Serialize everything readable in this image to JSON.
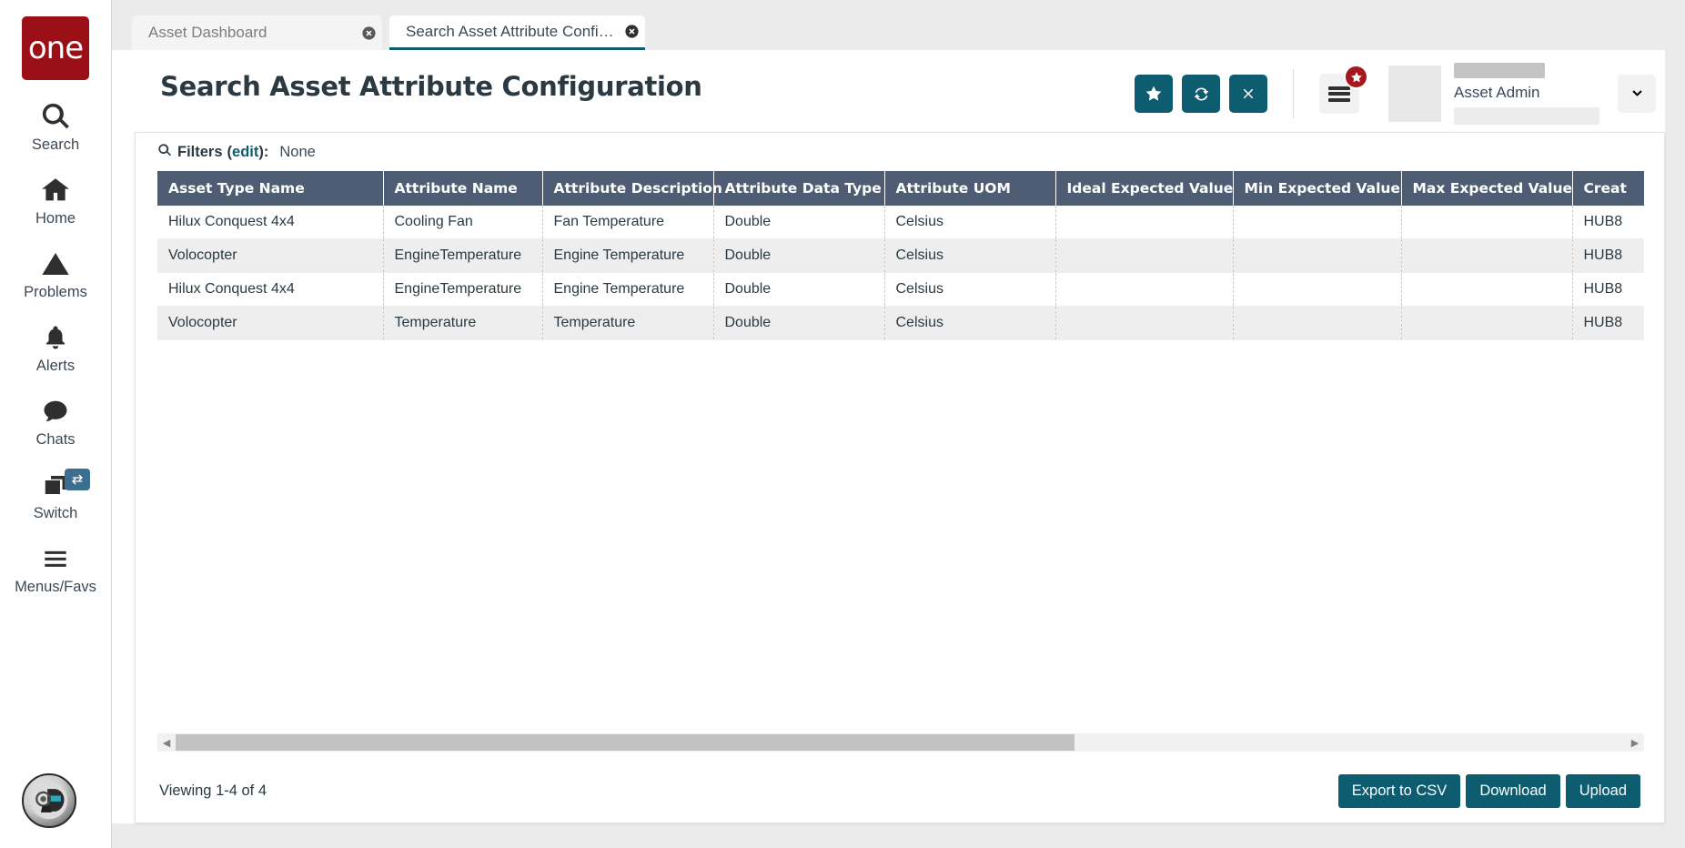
{
  "brand": {
    "logo_text": "one"
  },
  "sidebar": {
    "items": [
      {
        "label": "Search",
        "icon": "search-icon"
      },
      {
        "label": "Home",
        "icon": "home-icon"
      },
      {
        "label": "Problems",
        "icon": "warning-triangle-icon"
      },
      {
        "label": "Alerts",
        "icon": "bell-icon"
      },
      {
        "label": "Chats",
        "icon": "chat-bubble-icon"
      },
      {
        "label": "Switch",
        "icon": "windows-stack-icon",
        "badge_icon": "swap-arrows-icon"
      },
      {
        "label": "Menus/Favs",
        "icon": "hamburger-icon"
      }
    ],
    "avatar_icon": "robot-head-avatar-icon"
  },
  "tabs": [
    {
      "label": "Asset Dashboard",
      "active": false
    },
    {
      "label": "Search Asset Attribute Configura...",
      "active": true
    }
  ],
  "header": {
    "title": "Search Asset Attribute Configuration",
    "actions": [
      {
        "name": "favorite-button",
        "icon": "star-icon"
      },
      {
        "name": "refresh-button",
        "icon": "refresh-icon"
      },
      {
        "name": "close-button",
        "icon": "x-icon"
      }
    ],
    "menu_badge_icon": "star-icon",
    "user": {
      "role": "Asset Admin"
    }
  },
  "filters": {
    "icon": "search-icon",
    "label": "Filters",
    "edit_label": "edit",
    "separator": "):",
    "open_paren": "(",
    "value": "None"
  },
  "table": {
    "columns": [
      "Asset Type Name",
      "Attribute Name",
      "Attribute Description",
      "Attribute Data Type",
      "Attribute UOM",
      "Ideal Expected Value",
      "Min Expected Value",
      "Max Expected Value",
      "Creat"
    ],
    "rows": [
      [
        "Hilux Conquest 4x4",
        "Cooling Fan",
        "Fan Temperature",
        "Double",
        "Celsius",
        "",
        "",
        "",
        "HUB8"
      ],
      [
        "Volocopter",
        "EngineTemperature",
        "Engine Temperature",
        "Double",
        "Celsius",
        "",
        "",
        "",
        "HUB8"
      ],
      [
        "Hilux Conquest 4x4",
        "EngineTemperature",
        "Engine Temperature",
        "Double",
        "Celsius",
        "",
        "",
        "",
        "HUB8"
      ],
      [
        "Volocopter",
        "Temperature",
        "Temperature",
        "Double",
        "Celsius",
        "",
        "",
        "",
        "HUB8"
      ]
    ]
  },
  "footer": {
    "viewing_text": "Viewing 1-4 of 4",
    "buttons": [
      {
        "name": "export-to-csv-button",
        "label": "Export to CSV"
      },
      {
        "name": "download-button",
        "label": "Download"
      },
      {
        "name": "upload-button",
        "label": "Upload"
      }
    ]
  },
  "scrollbar": {
    "left_arrow": "◀",
    "right_arrow": "▶",
    "thumb_percent": 62
  },
  "colors": {
    "brand_red": "#9b1016",
    "teal_accent": "#0d5c70",
    "table_header": "#4e5d73",
    "badge_red": "#a3191f",
    "switch_badge_blue": "#3c6e8f"
  }
}
